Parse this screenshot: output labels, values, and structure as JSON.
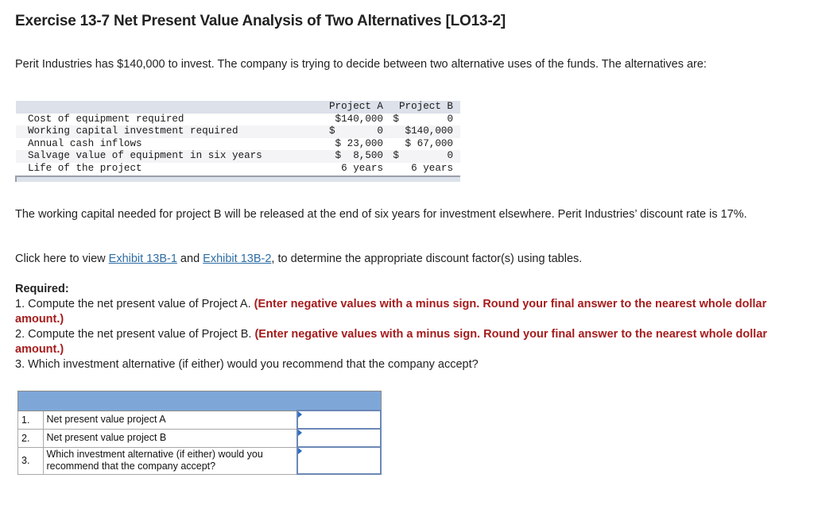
{
  "title": "Exercise 13-7 Net Present Value Analysis of Two Alternatives [LO13-2]",
  "intro": "Perit Industries has $140,000 to invest. The company is trying to decide between two alternative uses of the funds. The alternatives are:",
  "data_table": {
    "columns": [
      "Project A",
      "Project B"
    ],
    "rows": [
      {
        "label": "Cost of equipment required",
        "a": "$140,000",
        "b": "$        0"
      },
      {
        "label": "Working capital investment required",
        "a": "$       0",
        "b": "$140,000"
      },
      {
        "label": "Annual cash inflows",
        "a": "$ 23,000",
        "b": "$ 67,000"
      },
      {
        "label": "Salvage value of equipment in six years",
        "a": "$  8,500",
        "b": "$        0"
      },
      {
        "label": "Life of the project",
        "a": "6 years",
        "b": "6 years"
      }
    ]
  },
  "para2": "The working capital needed for project B will be released at the end of six years for investment elsewhere. Perit Industries’ discount rate is 17%.",
  "para3": {
    "prefix": "Click here to view ",
    "link1": "Exhibit 13B-1",
    "middle": " and ",
    "link2": "Exhibit 13B-2",
    "suffix": ", to determine the appropriate discount factor(s) using tables."
  },
  "required": {
    "heading": "Required:",
    "items": [
      {
        "text": "1. Compute the net present value of Project A. ",
        "note": "(Enter negative values with a minus sign. Round your final answer to the nearest whole dollar amount.)"
      },
      {
        "text": "2. Compute the net present value of Project B. ",
        "note": "(Enter negative values with a minus sign. Round your final answer to the nearest whole dollar amount.)"
      },
      {
        "text": "3. Which investment alternative (if either) would you recommend that the company accept?",
        "note": ""
      }
    ]
  },
  "answer_table": {
    "rows": [
      {
        "num": "1.",
        "label": "Net present value project A",
        "value": ""
      },
      {
        "num": "2.",
        "label": "Net present value project B",
        "value": ""
      },
      {
        "num": "3.",
        "label": "Which investment alternative (if either) would you recommend that the company accept?",
        "value": ""
      }
    ]
  }
}
